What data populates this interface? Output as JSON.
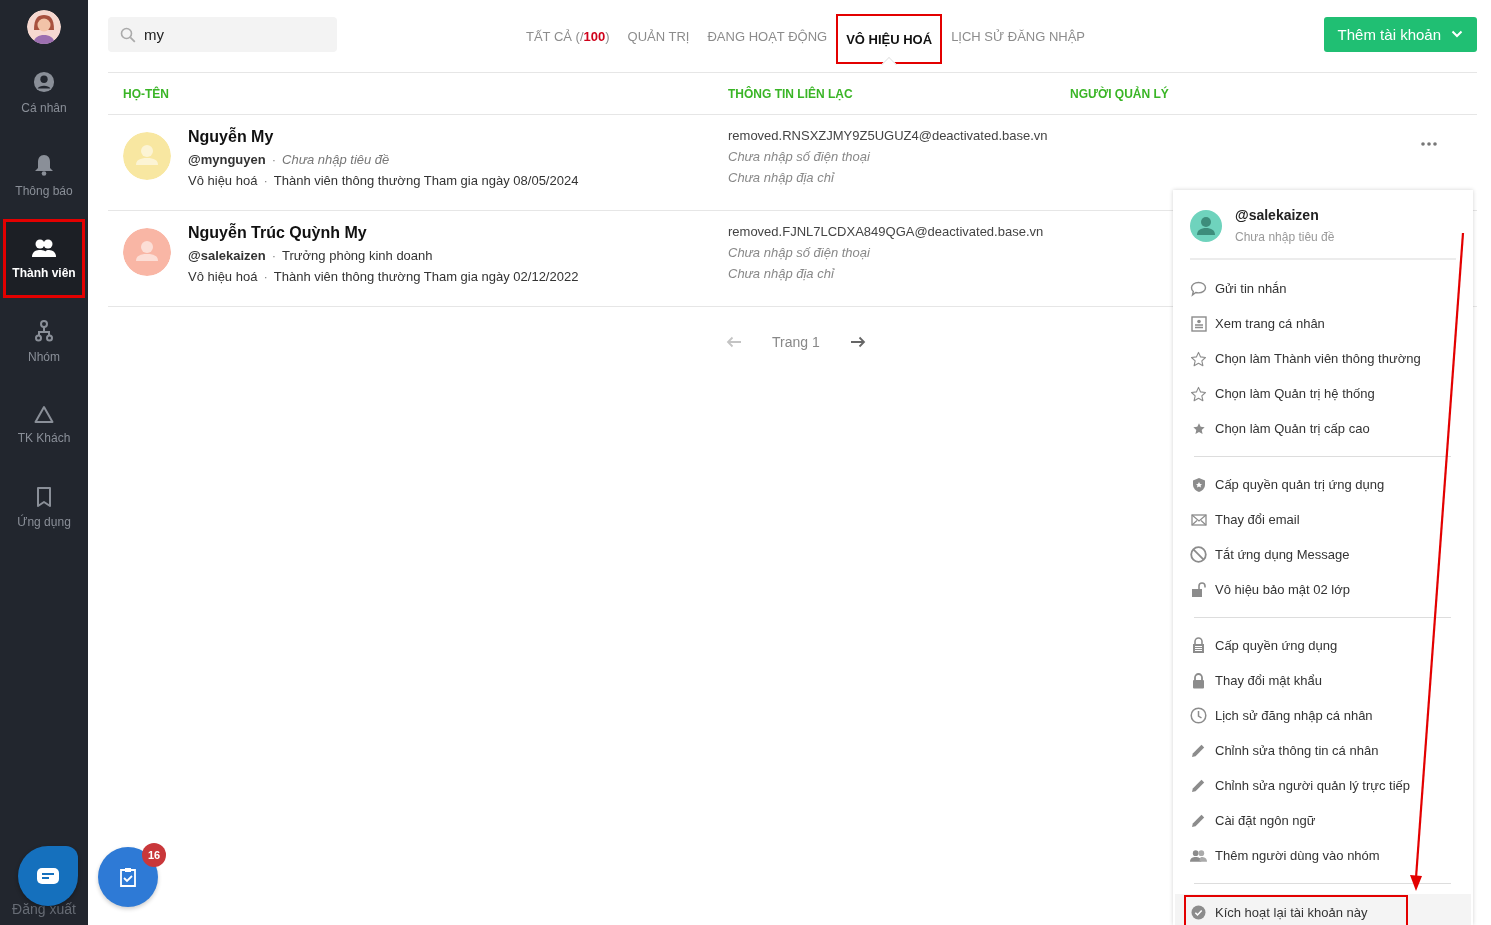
{
  "sidebar": {
    "items": [
      {
        "label": "Cá nhân",
        "kind": "person",
        "selected": false,
        "highlighted": false
      },
      {
        "label": "Thông báo",
        "kind": "bell",
        "selected": false,
        "highlighted": false
      },
      {
        "label": "Thành viên",
        "kind": "members",
        "selected": true,
        "highlighted": true
      },
      {
        "label": "Nhóm",
        "kind": "groups",
        "selected": false,
        "highlighted": false
      },
      {
        "label": "TK Khách",
        "kind": "guest",
        "selected": false,
        "highlighted": false
      },
      {
        "label": "Ứng dụng",
        "kind": "apps",
        "selected": false,
        "highlighted": false
      }
    ],
    "logout": "Đăng xuất"
  },
  "search": {
    "value": "my"
  },
  "tabs": [
    {
      "label": "TẤT CẢ (/**100**)",
      "selected": false,
      "highlighted": false
    },
    {
      "label": "QUẢN TRỊ",
      "selected": false,
      "highlighted": false
    },
    {
      "label": "ĐANG HOẠT ĐỘNG",
      "selected": false,
      "highlighted": false
    },
    {
      "label": "VÔ HIỆU HOÁ",
      "selected": true,
      "highlighted": true
    },
    {
      "label": "LỊCH SỬ ĐĂNG NHẬP",
      "selected": false,
      "highlighted": false
    }
  ],
  "add_button": "Thêm tài khoản",
  "separator": "·",
  "table": {
    "columns": [
      "HỌ-TÊN",
      "THÔNG TIN LIÊN LẠC",
      "NGƯỜI QUẢN LÝ"
    ],
    "rows": [
      {
        "name": "Nguyễn My",
        "handle": "@mynguyen",
        "title": "Chưa nhập tiêu đề",
        "title_missing": true,
        "status": "Vô hiệu hoá",
        "role": "Thành viên thông thường Tham gia ngày 08/05/2024",
        "email": "removed.RNSXZJMY9Z5UGUZ4@deactivated.base.vn",
        "phone": "Chưa nhập số điện thoại",
        "address": "Chưa nhập địa chỉ",
        "color": "#f8e7a1",
        "has_more": true
      },
      {
        "name": "Nguyễn Trúc Quỳnh My",
        "handle": "@salekaizen",
        "title": "Trưởng phòng kinh doanh",
        "title_missing": false,
        "status": "Vô hiệu hoá",
        "role": "Thành viên thông thường Tham gia ngày 02/12/2022",
        "email": "removed.FJNL7LCDXA849QGA@deactivated.base.vn",
        "phone": "Chưa nhập số điện thoại",
        "address": "Chưa nhập địa chỉ",
        "color": "#f9b6a5"
      }
    ]
  },
  "pagination": {
    "label": "Trang 1",
    "prev_disabled": true
  },
  "menu": {
    "handle": "@salekaizen",
    "title": "Chưa nhập tiêu đề",
    "groups": [
      {
        "items": [
          {
            "label": "Gửi tin nhắn",
            "kind": "chat",
            "highlighted": false
          },
          {
            "label": "Xem trang cá nhân",
            "kind": "profile",
            "highlighted": false
          },
          {
            "label": "Chọn làm Thành viên thông thường",
            "kind": "star-outline",
            "highlighted": false
          },
          {
            "label": "Chọn làm Quản trị hệ thống",
            "kind": "star-outline",
            "highlighted": false
          },
          {
            "label": "Chọn làm Quản trị cấp cao",
            "kind": "star",
            "highlighted": false
          }
        ]
      },
      {
        "items": [
          {
            "label": "Cấp quyền quản trị ứng dụng",
            "kind": "shield",
            "highlighted": false
          },
          {
            "label": "Thay đổi email",
            "kind": "mail",
            "highlighted": false
          },
          {
            "label": "Tắt ứng dụng Message",
            "kind": "block",
            "highlighted": false
          },
          {
            "label": "Vô hiệu bảo mật 02 lớp",
            "kind": "unlock",
            "highlighted": false
          }
        ]
      },
      {
        "items": [
          {
            "label": "Cấp quyền ứng dụng",
            "kind": "lock-list",
            "highlighted": false
          },
          {
            "label": "Thay đổi mật khẩu",
            "kind": "lock",
            "highlighted": false
          },
          {
            "label": "Lịch sử đăng nhập cá nhân",
            "kind": "clock",
            "highlighted": false
          },
          {
            "label": "Chỉnh sửa thông tin cá nhân",
            "kind": "pencil",
            "highlighted": false
          },
          {
            "label": "Chỉnh sửa người quản lý trực tiếp",
            "kind": "pencil",
            "highlighted": false
          },
          {
            "label": "Cài đặt ngôn ngữ",
            "kind": "pencil",
            "highlighted": false
          },
          {
            "label": "Thêm người dùng vào nhóm",
            "kind": "people",
            "highlighted": false
          }
        ]
      },
      {
        "items": [
          {
            "label": "Kích hoạt lại tài khoản này",
            "kind": "check-circle",
            "highlighted": true
          }
        ]
      }
    ]
  },
  "task_badge": "16"
}
